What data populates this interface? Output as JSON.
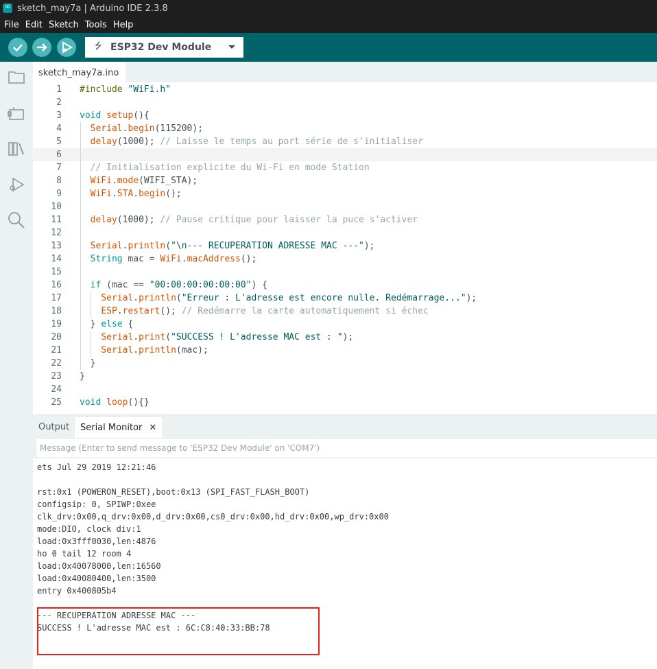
{
  "window": {
    "title": "sketch_may7a | Arduino IDE 2.3.8"
  },
  "menu": [
    "File",
    "Edit",
    "Sketch",
    "Tools",
    "Help"
  ],
  "toolbar": {
    "icons": [
      "verify-icon",
      "upload-icon",
      "debug-icon"
    ],
    "board": "ESP32 Dev Module"
  },
  "sidebar": {
    "icons": [
      "folder-icon",
      "boards-manager-icon",
      "library-icon",
      "debug-icon",
      "search-icon"
    ]
  },
  "editor": {
    "tab": "sketch_may7a.ino",
    "active_line": 6,
    "lines": [
      {
        "n": "1",
        "html": "<span class=\"pp\">#include</span> <span class=\"str\">\"WiFi.h\"</span>"
      },
      {
        "n": "2",
        "html": ""
      },
      {
        "n": "3",
        "html": "<span class=\"kw\">void</span> <span class=\"fn\">setup</span>(){"
      },
      {
        "n": "4",
        "html": "  <span class=\"fn\">Serial</span>.<span class=\"fn\">begin</span>(115200);"
      },
      {
        "n": "5",
        "html": "  <span class=\"fn\">delay</span>(1000); <span class=\"cm\">// Laisse le temps au port série de s'initialiser</span>"
      },
      {
        "n": "6",
        "html": ""
      },
      {
        "n": "7",
        "html": "  <span class=\"cm\">// Initialisation explicite du Wi-Fi en mode Station</span>"
      },
      {
        "n": "8",
        "html": "  <span class=\"fn\">WiFi</span>.<span class=\"fn\">mode</span>(WIFI_STA);"
      },
      {
        "n": "9",
        "html": "  <span class=\"fn\">WiFi</span>.<span class=\"fn\">STA</span>.<span class=\"fn\">begin</span>();"
      },
      {
        "n": "10",
        "html": ""
      },
      {
        "n": "11",
        "html": "  <span class=\"fn\">delay</span>(1000); <span class=\"cm\">// Pause critique pour laisser la puce s’activer</span>"
      },
      {
        "n": "12",
        "html": ""
      },
      {
        "n": "13",
        "html": "  <span class=\"fn\">Serial</span>.<span class=\"fn\">println</span>(<span class=\"str\">\"\\n--- RECUPERATION ADRESSE MAC ---\"</span>);"
      },
      {
        "n": "14",
        "html": "  <span class=\"ty\">String</span> mac = <span class=\"fn\">WiFi</span>.<span class=\"fn\">macAddress</span>();"
      },
      {
        "n": "15",
        "html": ""
      },
      {
        "n": "16",
        "html": "  <span class=\"kw\">if</span> (mac == <span class=\"str\">\"00:00:00:00:00:00\"</span>) {"
      },
      {
        "n": "17",
        "html": "    <span class=\"fn\">Serial</span>.<span class=\"fn\">println</span>(<span class=\"str\">\"Erreur : L'adresse est encore nulle. Redémarrage...\"</span>);"
      },
      {
        "n": "18",
        "html": "    <span class=\"fn\">ESP</span>.<span class=\"fn\">restart</span>(); <span class=\"cm\">// Redémarre la carte automatiquement si échec</span>"
      },
      {
        "n": "19",
        "html": "  } <span class=\"kw\">else</span> {"
      },
      {
        "n": "20",
        "html": "    <span class=\"fn\">Serial</span>.<span class=\"fn\">print</span>(<span class=\"str\">\"SUCCESS ! L'adresse MAC est : \"</span>);"
      },
      {
        "n": "21",
        "html": "    <span class=\"fn\">Serial</span>.<span class=\"fn\">println</span>(mac);"
      },
      {
        "n": "22",
        "html": "  }"
      },
      {
        "n": "23",
        "html": "}"
      },
      {
        "n": "24",
        "html": ""
      },
      {
        "n": "25",
        "html": "<span class=\"kw\">void</span> <span class=\"fn\">loop</span>(){}"
      }
    ]
  },
  "panel": {
    "tabs": [
      "Output",
      "Serial Monitor"
    ],
    "message_placeholder": "Message (Enter to send message to 'ESP32 Dev Module' on 'COM7')",
    "serial_lines": [
      "ets Jul 29 2019 12:21:46",
      "",
      "rst:0x1 (POWERON_RESET),boot:0x13 (SPI_FAST_FLASH_BOOT)",
      "configsip: 0, SPIWP:0xee",
      "clk_drv:0x00,q_drv:0x00,d_drv:0x00,cs0_drv:0x00,hd_drv:0x00,wp_drv:0x00",
      "mode:DIO, clock div:1",
      "load:0x3fff0030,len:4876",
      "ho 0 tail 12 room 4",
      "load:0x40078000,len:16560",
      "load:0x40080400,len:3500",
      "entry 0x400805b4",
      "",
      "--- RECUPERATION ADRESSE MAC ---",
      "SUCCESS ! L'adresse MAC est : 6C:C8:40:33:BB:78"
    ]
  },
  "colors": {
    "teal_dark": "#006468",
    "teal_button": "#4db7bb",
    "highlight_border": "#e8201c"
  }
}
